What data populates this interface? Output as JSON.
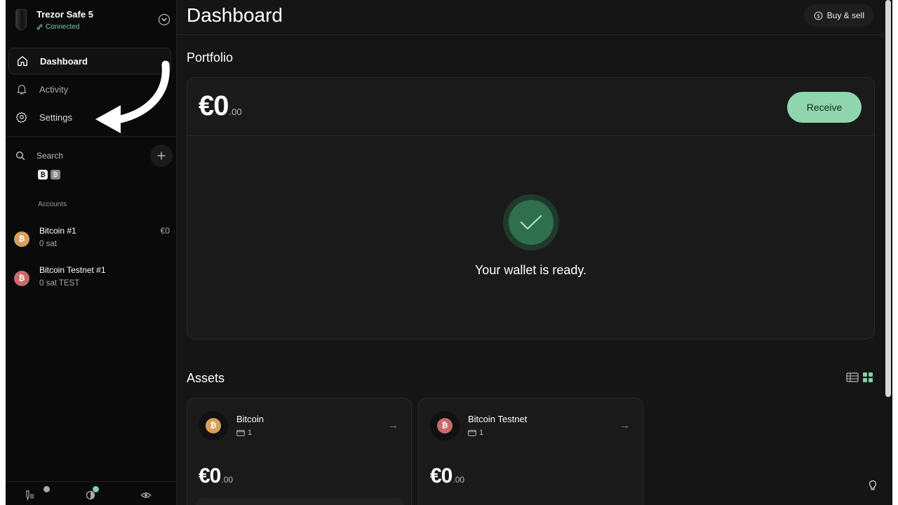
{
  "device": {
    "name": "Trezor Safe 5",
    "status": "Connected"
  },
  "nav": {
    "dashboard": "Dashboard",
    "activity": "Activity",
    "settings": "Settings"
  },
  "sidebar": {
    "search_label": "Search",
    "coin_filters": [
      "₿",
      "₿"
    ],
    "accounts_label": "Accounts",
    "accounts": [
      {
        "name": "Bitcoin #1",
        "balance": "0 sat",
        "fiat": "€0",
        "icon": "bitcoin-icon",
        "color": "#d9a05b"
      },
      {
        "name": "Bitcoin Testnet #1",
        "balance": "0 sat TEST",
        "fiat": "",
        "icon": "bitcoin-testnet-icon",
        "color": "#c96a6a"
      }
    ]
  },
  "header": {
    "title": "Dashboard",
    "buy_sell": "Buy & sell"
  },
  "portfolio": {
    "title": "Portfolio",
    "amount_int": "€0",
    "amount_dec": ".00",
    "receive": "Receive",
    "ready_text": "Your wallet is ready."
  },
  "assets": {
    "title": "Assets",
    "items": [
      {
        "name": "Bitcoin",
        "count": "1",
        "amount_int": "€0",
        "amount_dec": ".00",
        "color": "#d9a05b"
      },
      {
        "name": "Bitcoin Testnet",
        "count": "1",
        "amount_int": "€0",
        "amount_dec": ".00",
        "color": "#c96a6a"
      }
    ]
  },
  "colors": {
    "accent": "#8fd6ae",
    "background": "#151515",
    "sidebar": "#0a0a0a"
  }
}
